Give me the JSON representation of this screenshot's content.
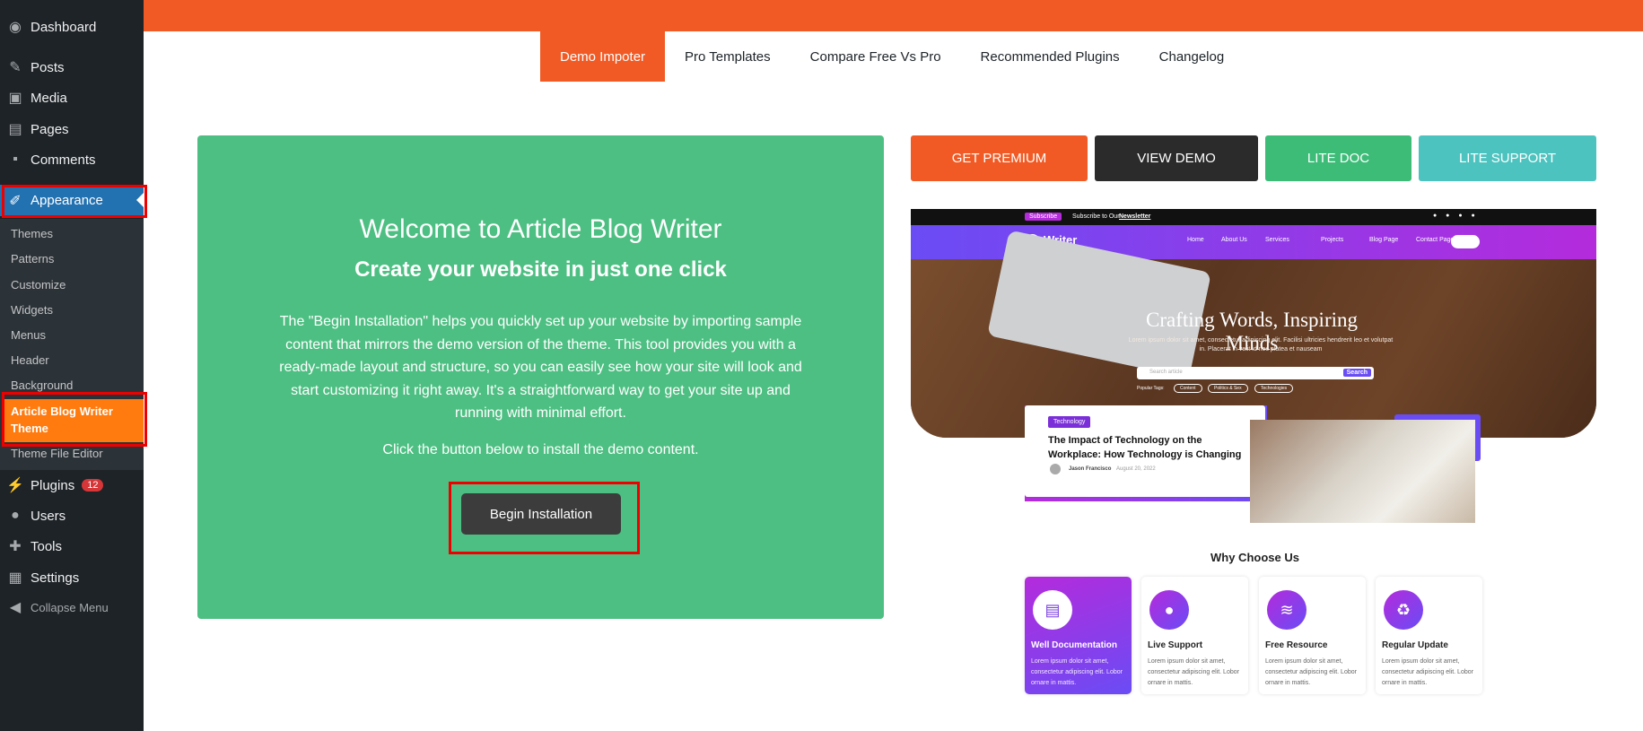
{
  "sidebar": {
    "dashboard": "Dashboard",
    "posts": "Posts",
    "media": "Media",
    "pages": "Pages",
    "comments": "Comments",
    "appearance": "Appearance",
    "submenu": [
      "Themes",
      "Patterns",
      "Customize",
      "Widgets",
      "Menus",
      "Header",
      "Background"
    ],
    "active_sub": "Article Blog Writer Theme",
    "theme_file_editor": "Theme File Editor",
    "plugins": "Plugins",
    "plugins_count": "12",
    "users": "Users",
    "tools": "Tools",
    "settings": "Settings",
    "collapse": "Collapse Menu"
  },
  "tabs": [
    "Demo Impoter",
    "Pro Templates",
    "Compare Free Vs Pro",
    "Recommended Plugins",
    "Changelog"
  ],
  "welcome": {
    "title": "Welcome to Article Blog Writer",
    "subtitle": "Create your website in just one click",
    "description": "The \"Begin Installation\" helps you quickly set up your website by importing sample content that mirrors the demo version of the theme. This tool provides you with a ready-made layout and structure, so you can easily see how your site will look and start customizing it right away. It's a straightforward way to get your site up and running with minimal effort.",
    "note": "Click the button below to install the demo content.",
    "button": "Begin Installation"
  },
  "actions": {
    "get_premium": "GET PREMIUM",
    "view_demo": "VIEW DEMO",
    "lite_doc": "LITE DOC",
    "lite_support": "LITE SUPPORT"
  },
  "preview": {
    "subscribe": "Subscribe",
    "newsletter_text": "Subscribe to Our",
    "newsletter": "Newsletter",
    "logo": "Writer",
    "nav": [
      "Home",
      "About Us",
      "Services",
      "Projects",
      "Blog Page",
      "Contact Page"
    ],
    "hero_title": "Crafting Words, Inspiring Minds",
    "hero_text": "Lorem ipsum dolor sit amet, consectetur adipiscing elit. Facilisi ultricies hendrerit leo et volutpat in. Placerat in velit id nec platea et nauseam",
    "search_placeholder": "Search article",
    "search_btn": "Search",
    "popular": "Popular Tags:",
    "tags": [
      "Content",
      "Politics & Sex",
      "Technologies"
    ],
    "card_tag": "Technology",
    "card_title": "The Impact of Technology on the Workplace: How Technology is Changing",
    "card_author": "Jason Francisco",
    "card_date": "August 20, 2022",
    "why": "Why Choose Us",
    "features": [
      {
        "title": "Well Documentation",
        "text": "Lorem ipsum dolor sit amet, consectetur adipiscing elit. Lobor ornare in mattis."
      },
      {
        "title": "Live Support",
        "text": "Lorem ipsum dolor sit amet, consectetur adipiscing elit. Lobor ornare in mattis."
      },
      {
        "title": "Free Resource",
        "text": "Lorem ipsum dolor sit amet, consectetur adipiscing elit. Lobor ornare in mattis."
      },
      {
        "title": "Regular Update",
        "text": "Lorem ipsum dolor sit amet, consectetur adipiscing elit. Lobor ornare in mattis."
      }
    ]
  },
  "colors": {
    "sidebar_bg": "#1d2327",
    "accent_orange": "#f15a24",
    "green_panel": "#4dbf82",
    "appearance_blue": "#2271b1"
  }
}
